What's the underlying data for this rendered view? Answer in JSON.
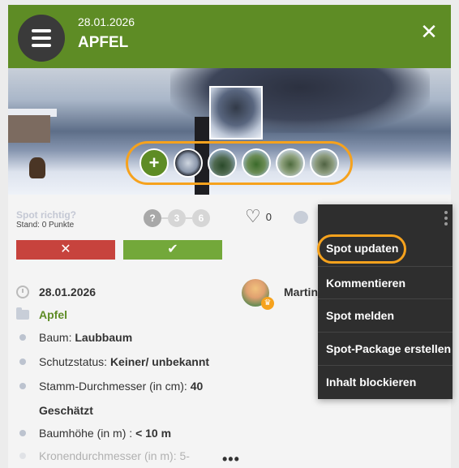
{
  "header": {
    "date": "28.01.2026",
    "title": "APFEL",
    "menu_icon": "hamburger-icon",
    "close_icon": "close-icon",
    "close_glyph": "✕",
    "color": "#5e8c25"
  },
  "photo": {
    "add_glyph": "+",
    "thumb_count": 5
  },
  "vote": {
    "label": "Spot richtig?",
    "sub": "Stand: 0 Punkte",
    "steps": [
      "?",
      "3",
      "6"
    ],
    "no_glyph": "✕",
    "yes_glyph": "✔"
  },
  "social": {
    "like_count": "0"
  },
  "details": {
    "date": "28.01.2026",
    "category": "Apfel",
    "rows": [
      {
        "label": "Baum:",
        "value": "Laubbaum"
      },
      {
        "label": "Schutzstatus:",
        "value": "Keiner/ unbekannt"
      },
      {
        "label": "Stamm-Durchmesser (in cm):",
        "value": "40"
      },
      {
        "label": "",
        "value": "Geschätzt"
      },
      {
        "label": "Baumhöhe (in m) :",
        "value": "< 10 m"
      },
      {
        "label": "Kronendurchmesser (in m): 5-",
        "value": ""
      }
    ],
    "more": "•••"
  },
  "user": {
    "name": "Martin",
    "crown_glyph": "♛"
  },
  "context_menu": {
    "items": [
      "Spot updaten",
      "Kommentieren",
      "Spot melden",
      "Spot-Package erstellen",
      "Inhalt blockieren"
    ]
  },
  "colors": {
    "accent_ring": "#f6a21d",
    "no_button": "#c7433d",
    "yes_button": "#73a83a",
    "menu_bg": "#2e2e2e"
  }
}
